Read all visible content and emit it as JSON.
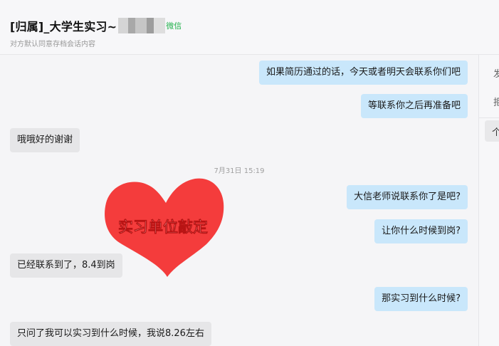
{
  "header": {
    "title": "[归属]_大学生实习~",
    "platform": "微信",
    "subtitle": "对方默认同意存档会话内容"
  },
  "messages": [
    {
      "side": "right",
      "text": "如果简历通过的话，今天或者明天会联系你们吧"
    },
    {
      "side": "right",
      "text": "等联系你之后再准备吧"
    },
    {
      "side": "left",
      "text": "哦哦好的谢谢"
    },
    {
      "side": "center",
      "text": "7月31日 15:19"
    },
    {
      "side": "left",
      "sticker": "heart-sticker",
      "text": "实习单位敲定",
      "color": "#f43c3c"
    },
    {
      "side": "right",
      "text": "大信老师说联系你了是吧?"
    },
    {
      "side": "right",
      "text": "让你什么时候到岗?"
    },
    {
      "side": "left",
      "text": "已经联系到了，8.4到岗"
    },
    {
      "side": "right",
      "text": "那实习到什么时候?"
    },
    {
      "side": "left",
      "text": "只问了我可以实习到什么时候，我说8.26左右"
    }
  ],
  "side_panel": {
    "tabs": [
      "发",
      "拒"
    ],
    "active_item": "个"
  },
  "colors": {
    "right_bubble": "#c9e7fb",
    "left_bubble": "#e6e6e8",
    "platform_green": "#22b14c",
    "sticker_red": "#f43c3c"
  }
}
